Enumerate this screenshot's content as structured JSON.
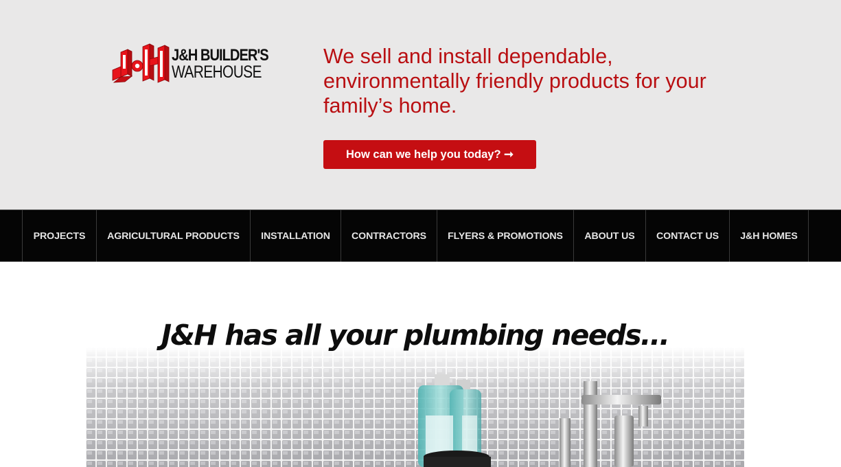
{
  "brand": {
    "line1": "J&H BUILDER'S",
    "line2": "WAREHOUSE",
    "mark_color": "#e8141b"
  },
  "header": {
    "tagline": "We sell and install dependable, environmentally friendly products for your family’s home.",
    "cta_label": "How can we help you today? ➞",
    "accent_color": "#c50e12"
  },
  "nav": {
    "items": [
      {
        "label": "PROJECTS"
      },
      {
        "label": "AGRICULTURAL PRODUCTS"
      },
      {
        "label": "INSTALLATION"
      },
      {
        "label": "CONTRACTORS"
      },
      {
        "label": "FLYERS & PROMOTIONS"
      },
      {
        "label": "ABOUT US"
      },
      {
        "label": "CONTACT US"
      },
      {
        "label": "J&H HOMES"
      }
    ]
  },
  "hero": {
    "title": "J&H has all your plumbing needs...",
    "image": "bathroom-tile-sink-photo"
  }
}
